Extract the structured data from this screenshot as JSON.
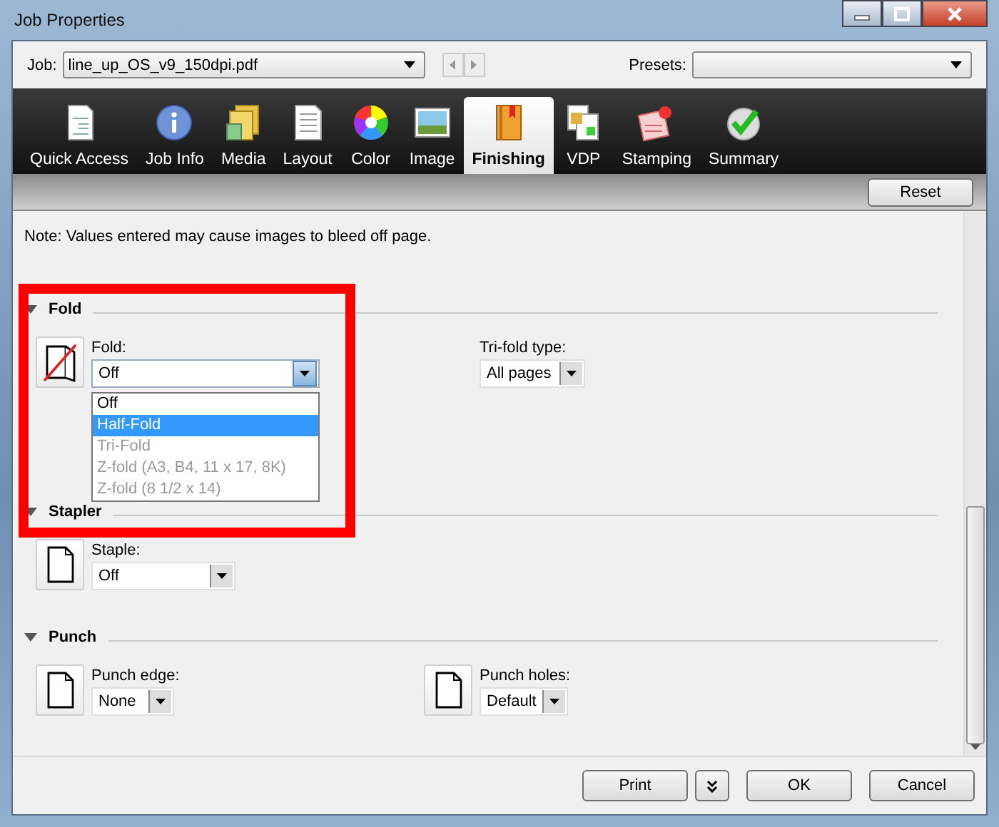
{
  "window": {
    "title": "Job Properties"
  },
  "toolbar": {
    "job_label": "Job:",
    "job_value": "line_up_OS_v9_150dpi.pdf",
    "presets_label": "Presets:"
  },
  "tabs": [
    {
      "label": "Quick Access",
      "selected": false
    },
    {
      "label": "Job Info",
      "selected": false
    },
    {
      "label": "Media",
      "selected": false
    },
    {
      "label": "Layout",
      "selected": false
    },
    {
      "label": "Color",
      "selected": false
    },
    {
      "label": "Image",
      "selected": false
    },
    {
      "label": "Finishing",
      "selected": true
    },
    {
      "label": "VDP",
      "selected": false
    },
    {
      "label": "Stamping",
      "selected": false
    },
    {
      "label": "Summary",
      "selected": false
    }
  ],
  "reset_button": "Reset",
  "note": "Note: Values entered may cause images to bleed off page.",
  "sections": [
    {
      "title": "Fold",
      "expanded": true,
      "fields": [
        {
          "kind": "crossed-icon",
          "label": "Fold:",
          "value": "Off",
          "options": [
            {
              "label": "Off",
              "highlighted": false,
              "disabled": false
            },
            {
              "label": "Half-Fold",
              "highlighted": true,
              "disabled": false
            },
            {
              "label": "Tri-Fold",
              "highlighted": false,
              "disabled": true
            },
            {
              "label": "Z-fold (A3, B4, 11 x 17, 8K)",
              "highlighted": false,
              "disabled": true
            },
            {
              "label": "Z-fold (8 1/2 x 14)",
              "highlighted": false,
              "disabled": true
            }
          ]
        },
        {
          "kind": "plain",
          "label": "Tri-fold type:",
          "value": "All pages"
        }
      ]
    },
    {
      "title": "Stapler",
      "expanded": true,
      "fields": [
        {
          "kind": "page-icon",
          "label": "Staple:",
          "value": "Off"
        }
      ]
    },
    {
      "title": "Punch",
      "expanded": true,
      "fields": [
        {
          "kind": "page-icon",
          "label": "Punch edge:",
          "value": "None"
        },
        {
          "kind": "page-icon",
          "label": "Punch holes:",
          "value": "Default"
        }
      ]
    }
  ],
  "footer": {
    "print": "Print",
    "ok": "OK",
    "cancel": "Cancel"
  }
}
